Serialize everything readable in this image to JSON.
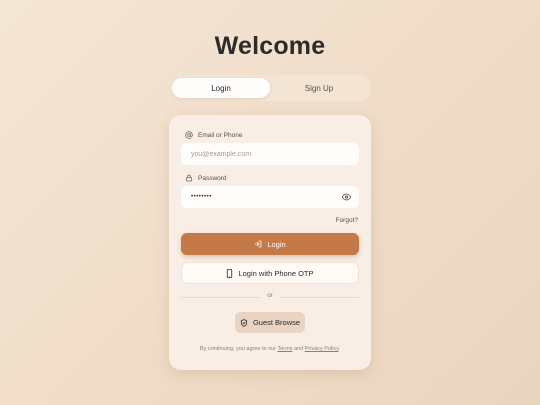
{
  "page": {
    "title": "Welcome"
  },
  "tabs": [
    {
      "label": "Login",
      "active": true
    },
    {
      "label": "Sign Up",
      "active": false
    }
  ],
  "form": {
    "email_label": "Email or Phone",
    "email_placeholder": "you@example.com",
    "email_value": "",
    "password_label": "Password",
    "password_value": "••••••••",
    "forgot_label": "Forgot?"
  },
  "buttons": {
    "login_label": "Login",
    "otp_label": "Login with Phone OTP",
    "divider_label": "or",
    "guest_label": "Guest Browse"
  },
  "terms": {
    "prefix": "By continuing, you agree to our",
    "terms_link": "Terms",
    "and": "and",
    "privacy_link": "Privacy Policy",
    "suffix": "."
  },
  "colors": {
    "accent": "#c47a48",
    "background": "#f2e2d1",
    "card": "#f8eee5"
  },
  "icons": {
    "email": "at-sign-icon",
    "password": "lock-icon",
    "toggle": "eye-icon",
    "login": "log-in-icon",
    "otp": "smartphone-icon",
    "guest": "shield-check-icon"
  }
}
